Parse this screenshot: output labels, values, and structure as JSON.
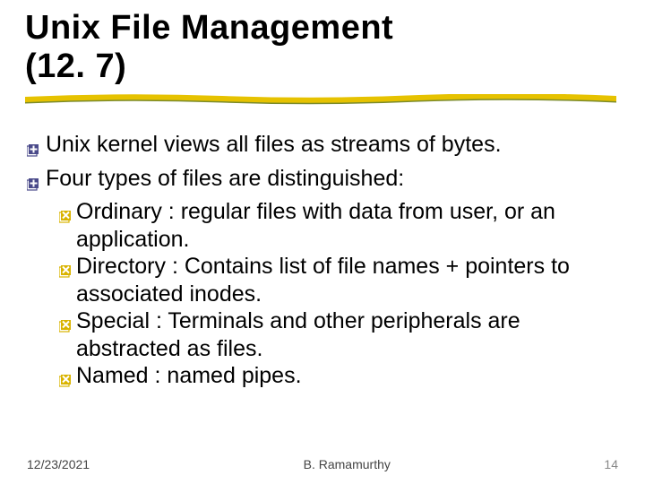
{
  "title_line1": "Unix File Management",
  "title_line2": "(12. 7)",
  "bullets": {
    "p1": "Unix kernel views all files as streams of bytes.",
    "p2": "Four types of files are distinguished:",
    "s1": "Ordinary : regular files with data from user, or an application.",
    "s2": "Directory : Contains list of file names + pointers to associated inodes.",
    "s3": "Special : Terminals and other peripherals are abstracted as files.",
    "s4": "Named : named pipes."
  },
  "footer": {
    "date": "12/23/2021",
    "author": "B. Ramamurthy",
    "page": "14"
  },
  "colors": {
    "bullet_primary": "#4a4a8a",
    "bullet_secondary": "#d9b300",
    "underline_main": "#e6c200",
    "underline_shadow": "#7a8a2a"
  }
}
